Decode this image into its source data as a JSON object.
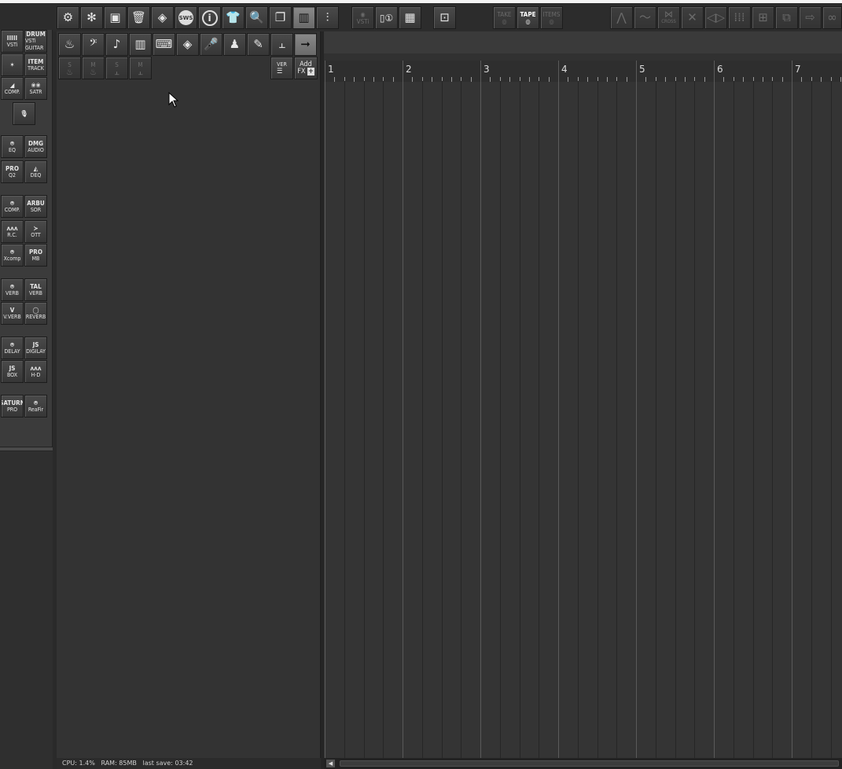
{
  "toolbar": {
    "main_icons": [
      "gear-icon",
      "settings-icon",
      "save-icon",
      "trash-icon",
      "render-icon",
      "sws-icon",
      "info-icon",
      "theme-icon",
      "zoom-icon",
      "window-icon",
      "spectrum-icon",
      "mixer-icon"
    ],
    "sws_label": "SWS",
    "vsti_label": "VSTi",
    "take_label": "TAKE",
    "tape_label": "TAPE",
    "items_label": "ITEMS",
    "right_icons": [
      "envelope-icon",
      "automation-icon",
      "crossfade-icon",
      "split-icon",
      "stretch-icon",
      "grid-icon",
      "group-icon",
      "route-icon",
      "send-icon",
      "link-icon"
    ],
    "crossfade_label": "CROSS"
  },
  "fx_toolbar": {
    "row1": [
      "drum-icon",
      "bass-clef-icon",
      "guitar-icon",
      "piano-icon",
      "keyboard-icon",
      "synth-icon",
      "mic-icon",
      "vocal-icon",
      "brush-icon",
      "waveform-icon",
      "arrow-right-icon"
    ],
    "row2": [
      {
        "sup": "S",
        "icon": "drum-s-icon"
      },
      {
        "sup": "M",
        "icon": "drum-m-icon"
      },
      {
        "sup": "S",
        "icon": "wave-s-icon"
      },
      {
        "sup": "M",
        "icon": "wave-m-icon"
      }
    ],
    "ver_label": "VER",
    "add_fx_line1": "Add",
    "add_fx_line2": "FX"
  },
  "sidebar": {
    "groups": [
      [
        {
          "l1": "IIIII",
          "l2": "VSTi"
        },
        {
          "l1": "DRUM",
          "l2": "VSTi GUITAR"
        }
      ],
      [
        {
          "l1": "✶",
          "l2": ""
        },
        {
          "l1": "ITEM",
          "l2": "TRACK"
        }
      ],
      [
        {
          "l1": "◢",
          "l2": "COMP."
        },
        {
          "l1": "❀❀",
          "l2": "SATR"
        }
      ],
      [
        {
          "l1": "🎙",
          "l2": ""
        }
      ],
      [
        {
          "l1": "⍟",
          "l2": "EQ"
        },
        {
          "l1": "DMG",
          "l2": "AUDIO"
        }
      ],
      [
        {
          "l1": "PRO",
          "l2": "Q2"
        },
        {
          "l1": "◭",
          "l2": "DEQ"
        }
      ],
      [
        {
          "l1": "⍟",
          "l2": "COMP."
        },
        {
          "l1": "ARBU",
          "l2": "SOR"
        }
      ],
      [
        {
          "l1": "ᴧᴧᴧ",
          "l2": "R.C."
        },
        {
          "l1": "≻",
          "l2": "OTT"
        }
      ],
      [
        {
          "l1": "⍟",
          "l2": "Xcomp"
        },
        {
          "l1": "PRO",
          "l2": "MB"
        }
      ],
      [
        {
          "l1": "⍟",
          "l2": "VERB"
        },
        {
          "l1": "TAL",
          "l2": "VERB"
        }
      ],
      [
        {
          "l1": "V",
          "l2": "V.VERB"
        },
        {
          "l1": "◯",
          "l2": "REVERB"
        }
      ],
      [
        {
          "l1": "⍟",
          "l2": "DELAY"
        },
        {
          "l1": "JS",
          "l2": "DIGILAY"
        }
      ],
      [
        {
          "l1": "JS",
          "l2": "BOX"
        },
        {
          "l1": "ᴧᴧᴧ",
          "l2": "H-D"
        }
      ],
      [
        {
          "l1": "SATURN",
          "l2": "PRO"
        },
        {
          "l1": "⍟",
          "l2": "ReaFir"
        }
      ]
    ]
  },
  "ruler": {
    "measures": [
      "1",
      "2",
      "3",
      "4",
      "5",
      "6",
      "7"
    ]
  },
  "status": {
    "text": "CPU: 1.4%   RAM: 85MB   last save: 03:42"
  }
}
